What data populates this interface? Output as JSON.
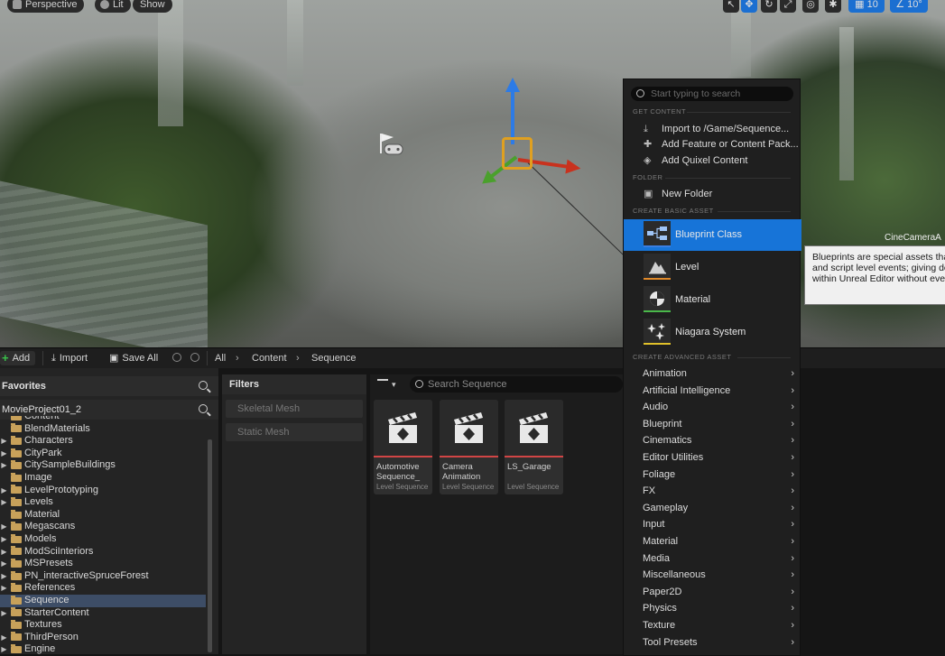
{
  "viewport": {
    "perspective_label": "Perspective",
    "lit_label": "Lit",
    "show_label": "Show",
    "grid_value": "10",
    "angle_value": "10°",
    "actor_label": "CineCameraA"
  },
  "tooltip": {
    "lines": [
      "Blueprints are special assets tha",
      "and script level events; giving de",
      "within Unreal Editor without ever"
    ]
  },
  "toolbar": {
    "add_label": "Add",
    "import_label": "Import",
    "save_all_label": "Save All",
    "breadcrumb": [
      "All",
      "Content",
      "Sequence"
    ]
  },
  "favorites": {
    "title": "Favorites"
  },
  "project": {
    "title": "MovieProject01_2"
  },
  "folders": [
    {
      "name": "Content",
      "expand": "",
      "selected": false
    },
    {
      "name": "BlendMaterials",
      "expand": "",
      "selected": false
    },
    {
      "name": "Characters",
      "expand": "▶",
      "selected": false
    },
    {
      "name": "CityPark",
      "expand": "▶",
      "selected": false
    },
    {
      "name": "CitySampleBuildings",
      "expand": "▶",
      "selected": false
    },
    {
      "name": "Image",
      "expand": "",
      "selected": false
    },
    {
      "name": "LevelPrototyping",
      "expand": "▶",
      "selected": false
    },
    {
      "name": "Levels",
      "expand": "▶",
      "selected": false
    },
    {
      "name": "Material",
      "expand": "",
      "selected": false
    },
    {
      "name": "Megascans",
      "expand": "▶",
      "selected": false
    },
    {
      "name": "Models",
      "expand": "▶",
      "selected": false
    },
    {
      "name": "ModSciInteriors",
      "expand": "▶",
      "selected": false
    },
    {
      "name": "MSPresets",
      "expand": "▶",
      "selected": false
    },
    {
      "name": "PN_interactiveSpruceForest",
      "expand": "▶",
      "selected": false
    },
    {
      "name": "References",
      "expand": "▶",
      "selected": false
    },
    {
      "name": "Sequence",
      "expand": "",
      "selected": true
    },
    {
      "name": "StarterContent",
      "expand": "▶",
      "selected": false
    },
    {
      "name": "Textures",
      "expand": "",
      "selected": false
    },
    {
      "name": "ThirdPerson",
      "expand": "▶",
      "selected": false
    },
    {
      "name": "Engine",
      "expand": "▶",
      "selected": false
    }
  ],
  "filters": {
    "title": "Filters",
    "items": [
      "Skeletal Mesh",
      "Static Mesh"
    ]
  },
  "assets": {
    "search_placeholder": "Search Sequence",
    "tiles": [
      {
        "name": "Automotive Sequence_",
        "type": "Level Sequence"
      },
      {
        "name": "Camera Animation",
        "type": "Level Sequence"
      },
      {
        "name": "LS_Garage",
        "type": "Level Sequence"
      }
    ]
  },
  "menu": {
    "search_placeholder": "Start typing to search",
    "sections": {
      "get_content": "GET CONTENT",
      "folder": "FOLDER",
      "basic": "CREATE BASIC ASSET",
      "advanced": "CREATE ADVANCED ASSET"
    },
    "get_content_items": [
      "Import to /Game/Sequence...",
      "Add Feature or Content Pack...",
      "Add Quixel Content"
    ],
    "folder_items": [
      "New Folder"
    ],
    "basic_items": [
      {
        "label": "Blueprint Class",
        "color": "#3a7ee0"
      },
      {
        "label": "Level",
        "color": "#e08a2a"
      },
      {
        "label": "Material",
        "color": "#4ab84a"
      },
      {
        "label": "Niagara System",
        "color": "#e0c02a"
      }
    ],
    "advanced_items": [
      "Animation",
      "Artificial Intelligence",
      "Audio",
      "Blueprint",
      "Cinematics",
      "Editor Utilities",
      "Foliage",
      "FX",
      "Gameplay",
      "Input",
      "Material",
      "Media",
      "Miscellaneous",
      "Paper2D",
      "Physics",
      "Texture",
      "Tool Presets"
    ]
  }
}
